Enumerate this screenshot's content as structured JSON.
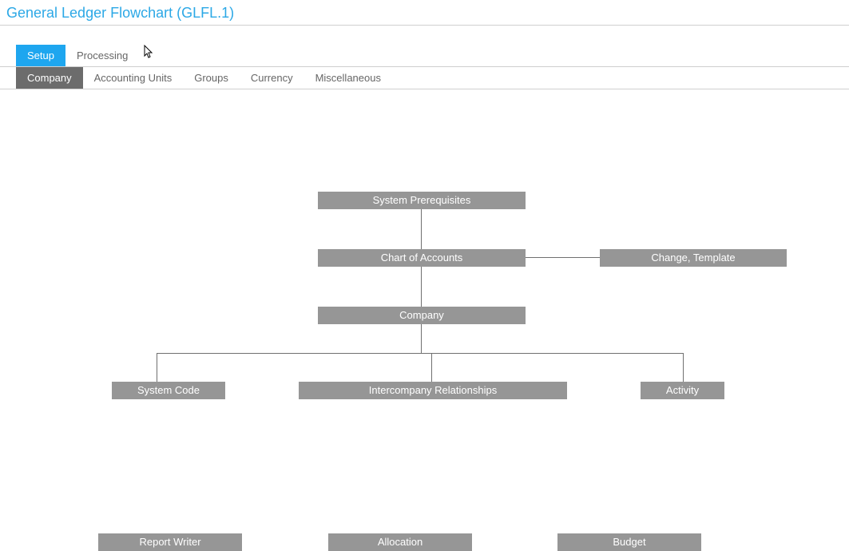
{
  "header": {
    "title": "General Ledger Flowchart (GLFL.1)"
  },
  "tabs": {
    "primary": [
      {
        "label": "Setup",
        "active": true
      },
      {
        "label": "Processing",
        "active": false
      }
    ],
    "secondary": [
      {
        "label": "Company",
        "active": true
      },
      {
        "label": "Accounting Units",
        "active": false
      },
      {
        "label": "Groups",
        "active": false
      },
      {
        "label": "Currency",
        "active": false
      },
      {
        "label": "Miscellaneous",
        "active": false
      }
    ]
  },
  "nodes": {
    "system_prerequisites": "System Prerequisites",
    "chart_of_accounts": "Chart of Accounts",
    "change_template": "Change, Template",
    "company": "Company",
    "system_code": "System Code",
    "intercompany": "Intercompany Relationships",
    "activity": "Activity",
    "report_writer": "Report Writer",
    "allocation": "Allocation",
    "budget": "Budget"
  }
}
